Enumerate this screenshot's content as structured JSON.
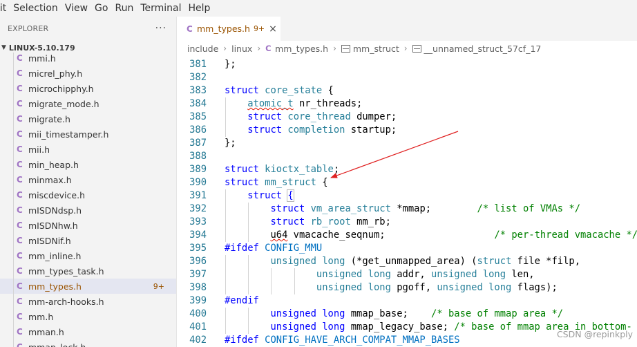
{
  "menubar": [
    "lit",
    "Selection",
    "View",
    "Go",
    "Run",
    "Terminal",
    "Help"
  ],
  "explorer": {
    "title": "EXPLORER",
    "more": "···",
    "folder": "LINUX-5.10.179",
    "folder_chevron": "chevron-down",
    "files": [
      {
        "icon": "C",
        "name": "mmi.h"
      },
      {
        "icon": "C",
        "name": "micrel_phy.h"
      },
      {
        "icon": "C",
        "name": "microchipphy.h"
      },
      {
        "icon": "C",
        "name": "migrate_mode.h"
      },
      {
        "icon": "C",
        "name": "migrate.h"
      },
      {
        "icon": "C",
        "name": "mii_timestamper.h"
      },
      {
        "icon": "C",
        "name": "mii.h"
      },
      {
        "icon": "C",
        "name": "min_heap.h"
      },
      {
        "icon": "C",
        "name": "minmax.h"
      },
      {
        "icon": "C",
        "name": "miscdevice.h"
      },
      {
        "icon": "C",
        "name": "mISDNdsp.h"
      },
      {
        "icon": "C",
        "name": "mISDNhw.h"
      },
      {
        "icon": "C",
        "name": "mISDNif.h"
      },
      {
        "icon": "C",
        "name": "mm_inline.h"
      },
      {
        "icon": "C",
        "name": "mm_types_task.h"
      },
      {
        "icon": "C",
        "name": "mm_types.h",
        "badge": "9+",
        "selected": true
      },
      {
        "icon": "C",
        "name": "mm-arch-hooks.h"
      },
      {
        "icon": "C",
        "name": "mm.h"
      },
      {
        "icon": "C",
        "name": "mman.h"
      },
      {
        "icon": "C",
        "name": "mmap_lock.h"
      }
    ]
  },
  "tab": {
    "icon": "C",
    "label": "mm_types.h",
    "badge": "9+",
    "close": "×"
  },
  "breadcrumb": {
    "parts": [
      "include",
      "linux"
    ],
    "file": "mm_types.h",
    "symbols": [
      "mm_struct",
      "__unnamed_struct_57cf_17"
    ],
    "file_icon": "C",
    "symbol_icon": "struct-icon"
  },
  "code": {
    "lines": [
      {
        "n": "381",
        "ind": 0,
        "t": [
          [
            "p",
            "};"
          ]
        ]
      },
      {
        "n": "382",
        "ind": 0,
        "t": []
      },
      {
        "n": "383",
        "ind": 0,
        "t": [
          [
            "k",
            "struct"
          ],
          [
            "p",
            " "
          ],
          [
            "t",
            "core_state"
          ],
          [
            "p",
            " {"
          ]
        ]
      },
      {
        "n": "384",
        "ind": 1,
        "t": [
          [
            "p",
            "    "
          ],
          [
            "tw",
            "atomic_t"
          ],
          [
            "p",
            " nr_threads;"
          ]
        ]
      },
      {
        "n": "385",
        "ind": 1,
        "t": [
          [
            "p",
            "    "
          ],
          [
            "k",
            "struct"
          ],
          [
            "p",
            " "
          ],
          [
            "t",
            "core_thread"
          ],
          [
            "p",
            " dumper;"
          ]
        ]
      },
      {
        "n": "386",
        "ind": 1,
        "t": [
          [
            "p",
            "    "
          ],
          [
            "k",
            "struct"
          ],
          [
            "p",
            " "
          ],
          [
            "t",
            "completion"
          ],
          [
            "p",
            " startup;"
          ]
        ]
      },
      {
        "n": "387",
        "ind": 0,
        "t": [
          [
            "p",
            "};"
          ]
        ]
      },
      {
        "n": "388",
        "ind": 0,
        "t": []
      },
      {
        "n": "389",
        "ind": 0,
        "t": [
          [
            "k",
            "struct"
          ],
          [
            "p",
            " "
          ],
          [
            "t",
            "kioctx_table"
          ],
          [
            "p",
            ";"
          ]
        ]
      },
      {
        "n": "390",
        "ind": 0,
        "t": [
          [
            "k",
            "struct"
          ],
          [
            "p",
            " "
          ],
          [
            "t",
            "mm_struct"
          ],
          [
            "p",
            " {"
          ]
        ]
      },
      {
        "n": "391",
        "ind": 1,
        "t": [
          [
            "p",
            "    "
          ],
          [
            "k",
            "struct"
          ],
          [
            "p",
            " "
          ],
          [
            "b",
            "{"
          ]
        ]
      },
      {
        "n": "392",
        "ind": 2,
        "t": [
          [
            "p",
            "        "
          ],
          [
            "k",
            "struct"
          ],
          [
            "p",
            " "
          ],
          [
            "t",
            "vm_area_struct"
          ],
          [
            "p",
            " *mmap;        "
          ],
          [
            "c",
            "/* list of VMAs */"
          ]
        ]
      },
      {
        "n": "393",
        "ind": 2,
        "t": [
          [
            "p",
            "        "
          ],
          [
            "k",
            "struct"
          ],
          [
            "p",
            " "
          ],
          [
            "t",
            "rb_root"
          ],
          [
            "p",
            " mm_rb;"
          ]
        ]
      },
      {
        "n": "394",
        "ind": 2,
        "t": [
          [
            "p",
            "        "
          ],
          [
            "pw",
            "u64"
          ],
          [
            "p",
            " vmacache_seqnum;                   "
          ],
          [
            "c",
            "/* per-thread vmacache */"
          ]
        ]
      },
      {
        "n": "395",
        "ind": 0,
        "t": [
          [
            "d",
            "#ifdef"
          ],
          [
            "p",
            " "
          ],
          [
            "m",
            "CONFIG_MMU"
          ]
        ]
      },
      {
        "n": "396",
        "ind": 2,
        "t": [
          [
            "p",
            "        "
          ],
          [
            "t",
            "unsigned long"
          ],
          [
            "p",
            " (*get_unmapped_area) ("
          ],
          [
            "t",
            "struct"
          ],
          [
            "p",
            " file *filp,"
          ]
        ]
      },
      {
        "n": "397",
        "ind": 4,
        "t": [
          [
            "p",
            "                "
          ],
          [
            "t",
            "unsigned long"
          ],
          [
            "p",
            " addr, "
          ],
          [
            "t",
            "unsigned long"
          ],
          [
            "p",
            " len,"
          ]
        ]
      },
      {
        "n": "398",
        "ind": 4,
        "t": [
          [
            "p",
            "                "
          ],
          [
            "t",
            "unsigned long"
          ],
          [
            "p",
            " pgoff, "
          ],
          [
            "t",
            "unsigned long"
          ],
          [
            "p",
            " flags);"
          ]
        ]
      },
      {
        "n": "399",
        "ind": 0,
        "t": [
          [
            "d",
            "#endif"
          ]
        ]
      },
      {
        "n": "400",
        "ind": 2,
        "t": [
          [
            "p",
            "        "
          ],
          [
            "k",
            "unsigned long"
          ],
          [
            "p",
            " mmap_base;    "
          ],
          [
            "c",
            "/* base of mmap area */"
          ]
        ]
      },
      {
        "n": "401",
        "ind": 2,
        "t": [
          [
            "p",
            "        "
          ],
          [
            "k",
            "unsigned long"
          ],
          [
            "p",
            " mmap_legacy_base; "
          ],
          [
            "c",
            "/* base of mmap area in bottom-"
          ]
        ]
      },
      {
        "n": "402",
        "ind": 0,
        "t": [
          [
            "d",
            "#ifdef"
          ],
          [
            "p",
            " "
          ],
          [
            "m",
            "CONFIG_HAVE_ARCH_COMPAT_MMAP_BASES"
          ]
        ]
      }
    ]
  },
  "watermark": "CSDN @repinkply",
  "colors": {
    "accent": "#9a5300",
    "c_icon": "#a074c4",
    "annotation_arrow": "#e02020"
  }
}
